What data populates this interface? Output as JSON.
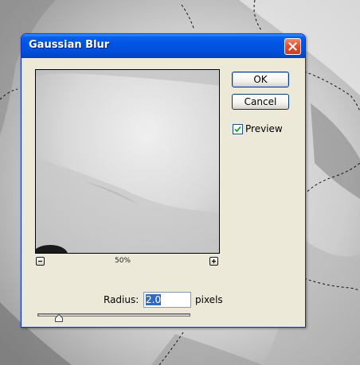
{
  "dialog": {
    "title": "Gaussian Blur",
    "close_icon": "close-x-icon"
  },
  "preview": {
    "zoom_level": "50%",
    "zoom_out_icon": "minus-icon",
    "zoom_in_icon": "plus-icon"
  },
  "buttons": {
    "ok_label": "OK",
    "cancel_label": "Cancel"
  },
  "options": {
    "preview_label": "Preview",
    "preview_checked": true
  },
  "radius": {
    "label": "Radius:",
    "value": "2.0",
    "units": "pixels",
    "slider_fraction": 0.1
  },
  "colors": {
    "title_bar": "#0054e3",
    "dialog_face": "#ece9d8",
    "close_button": "#de5432",
    "selection": "#316ac5"
  }
}
